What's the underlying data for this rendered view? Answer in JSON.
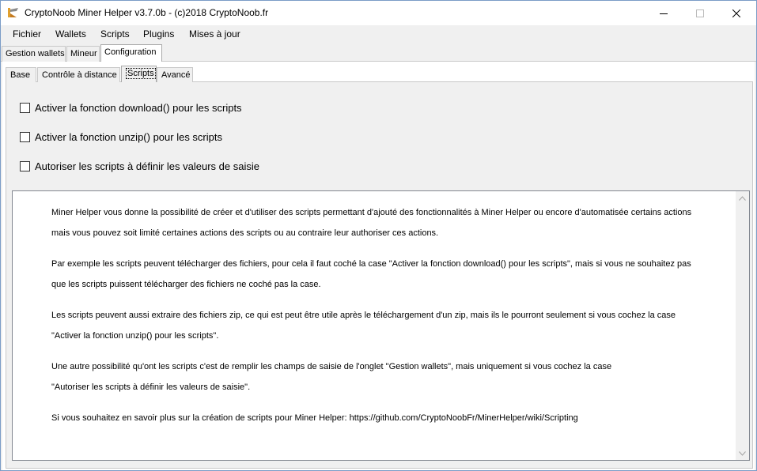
{
  "window": {
    "title": "CryptoNoob Miner Helper v3.7.0b - (c)2018 CryptoNoob.fr",
    "icon": "pickaxe-app-icon"
  },
  "menu": [
    "Fichier",
    "Wallets",
    "Scripts",
    "Plugins",
    "Mises à jour"
  ],
  "main_tabs": [
    "Gestion wallets",
    "Mineur",
    "Configuration"
  ],
  "main_tabs_active": "Configuration",
  "sub_tabs": [
    "Base",
    "Contrôle à distance",
    "Scripts",
    "Avancé"
  ],
  "sub_tabs_active": "Scripts",
  "options": [
    {
      "label": "Activer la fonction download() pour les scripts",
      "checked": false
    },
    {
      "label": "Activer la fonction unzip() pour les scripts",
      "checked": false
    },
    {
      "label": "Autoriser les scripts à définir les valeurs de saisie",
      "checked": false
    }
  ],
  "info": {
    "paragraphs": [
      [
        "Miner Helper vous donne la possibilité de créer et d'utiliser des scripts permettant d'ajouté des fonctionnalités à Miner Helper ou encore d'automatisée certains actions",
        "mais vous pouvez soit limité certaines actions des scripts ou au contraire leur authoriser ces actions."
      ],
      [
        "Par exemple les scripts peuvent télécharger des fichiers, pour cela il faut coché la case \"Activer la fonction download() pour les scripts\", mais si vous ne souhaitez pas",
        "que les scripts puissent télécharger des fichiers ne coché pas la case."
      ],
      [
        "Les scripts peuvent aussi extraire des fichiers zip, ce qui est peut être utile après le téléchargement d'un zip, mais ils le pourront seulement si vous cochez la case",
        "\"Activer la fonction unzip() pour les scripts\"."
      ],
      [
        "Une autre possibilité qu'ont les scripts c'est de remplir les champs de saisie de l'onglet \"Gestion wallets\", mais uniquement si vous cochez la case",
        "\"Autoriser les scripts à définir les valeurs de saisie\"."
      ],
      [
        "Si vous souhaitez en savoir plus sur la création de scripts pour Miner Helper: https://github.com/CryptoNoobFr/MinerHelper/wiki/Scripting"
      ]
    ]
  }
}
